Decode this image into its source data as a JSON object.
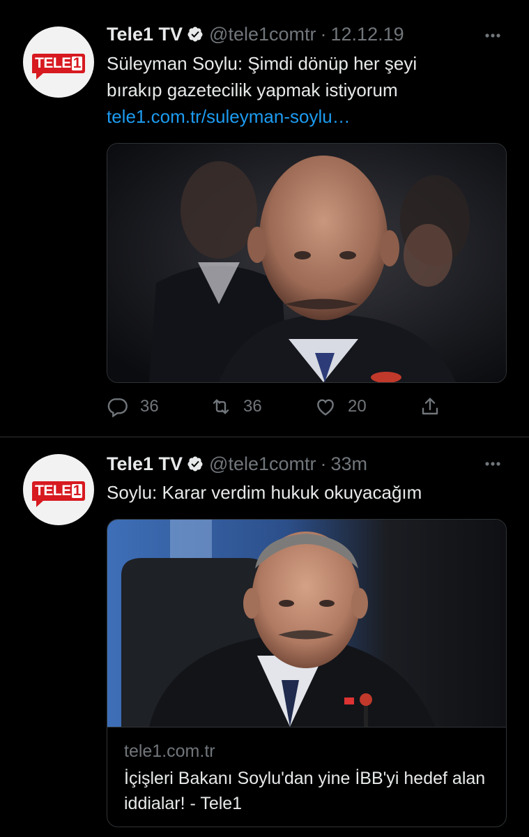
{
  "tweets": [
    {
      "avatar_logo": "TELE1",
      "name": "Tele1 TV",
      "handle": "@tele1comtr",
      "separator": "·",
      "time": "12.12.19",
      "text": "Süleyman Soylu: Şimdi dönüp her şeyi bırakıp gazetecilik yapmak istiyorum",
      "link": "tele1.com.tr/suleyman-soylu…",
      "actions": {
        "replies": "36",
        "retweets": "36",
        "likes": "20"
      }
    },
    {
      "avatar_logo": "TELE1",
      "name": "Tele1 TV",
      "handle": "@tele1comtr",
      "separator": "·",
      "time": "33m",
      "text": "Soylu: Karar verdim hukuk okuyacağım",
      "card": {
        "domain": "tele1.com.tr",
        "title": "İçişleri Bakanı Soylu'dan yine İBB'yi hedef alan iddialar! - Tele1"
      }
    }
  ],
  "colors": {
    "background": "#000000",
    "text": "#e7e9ea",
    "secondary": "#71767b",
    "link": "#1d9bf0",
    "verified": "#e7e9ea",
    "brand_red": "#d71920"
  },
  "icons": [
    "verified-badge-icon",
    "more-icon",
    "reply-icon",
    "retweet-icon",
    "like-icon",
    "share-icon"
  ]
}
